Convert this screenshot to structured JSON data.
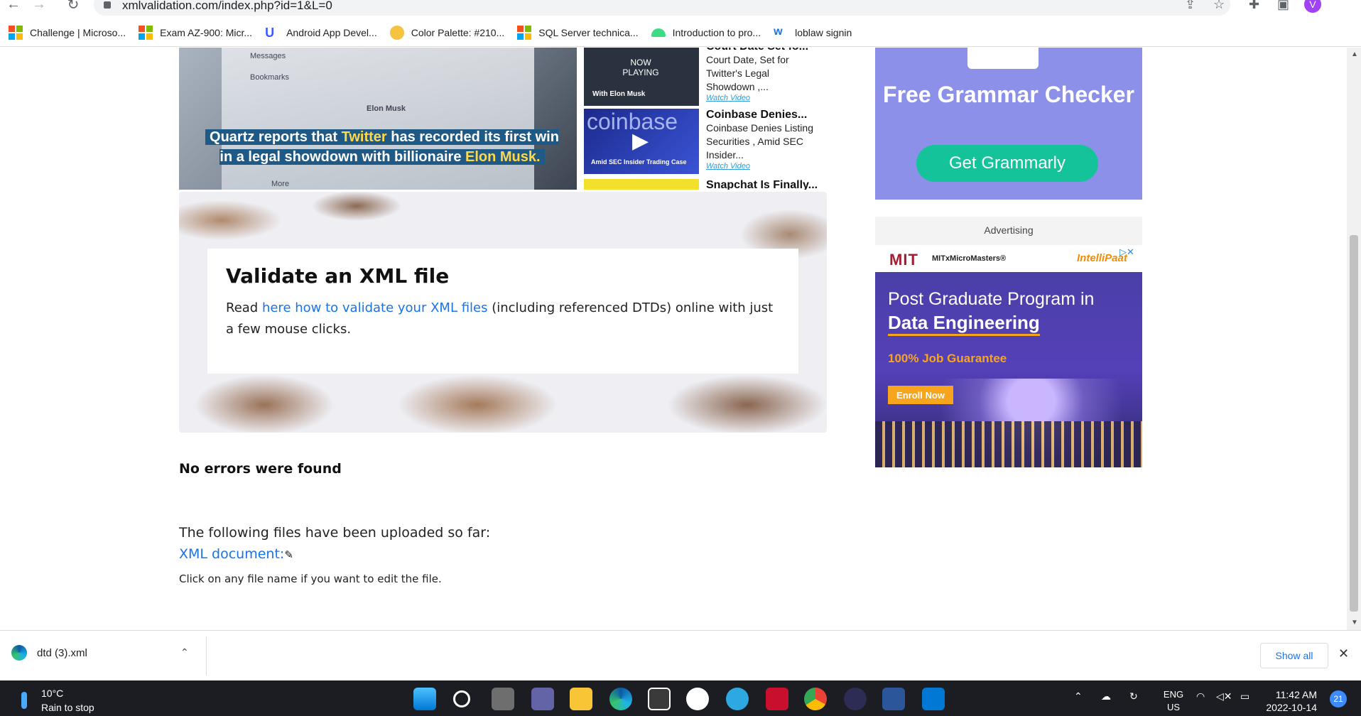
{
  "browser": {
    "url": "xmlvalidation.com/index.php?id=1&L=0",
    "profile_initial": "V",
    "bookmarks": [
      {
        "label": "Challenge | Microso...",
        "icon": "microsoft-icon"
      },
      {
        "label": "Exam AZ-900: Micr...",
        "icon": "microsoft-icon"
      },
      {
        "label": "Android App Devel...",
        "icon": "udacity-icon"
      },
      {
        "label": "Color Palette: #210...",
        "icon": "palette-icon"
      },
      {
        "label": "SQL Server technica...",
        "icon": "microsoft-icon"
      },
      {
        "label": "Introduction to pro...",
        "icon": "android-icon"
      },
      {
        "label": "loblaw signin",
        "icon": "w-icon"
      }
    ]
  },
  "hero_video": {
    "caption_part1": "Quartz reports that ",
    "caption_hl1": "Twitter",
    "caption_part2": " has recorded its first win in a legal showdown with billionaire ",
    "caption_hl2": "Elon Musk.",
    "side_items": [
      "Messages",
      "Bookmarks",
      "Elon Musk",
      "More"
    ]
  },
  "video_list": [
    {
      "title": "Court Date Set fo...",
      "desc": "Court Date, Set for Twitter's Legal Showdown ,...",
      "link": "Watch Video",
      "thumb_label": "NOW PLAYING",
      "thumb_sub": "With Elon Musk"
    },
    {
      "title": "Coinbase Denies...",
      "desc": "Coinbase Denies Listing Securities , Amid SEC Insider...",
      "link": "Watch Video",
      "thumb_label": "coinbase",
      "thumb_sub": "Amid SEC Insider Trading Case"
    },
    {
      "title": "Snapchat Is Finally...",
      "desc": "",
      "link": "",
      "thumb_label": "",
      "thumb_sub": ""
    }
  ],
  "validate": {
    "heading": "Validate an XML file",
    "text_before": "Read ",
    "link_text": "here how to validate your XML files",
    "text_after": " (including referenced DTDs) online with just a few mouse clicks."
  },
  "result": {
    "status": "No errors were found",
    "uploaded_text": "The following files have been uploaded so far:",
    "file_link": "XML document:",
    "hint": "Click on any file name if you want to edit the file."
  },
  "ad_grammarly": {
    "headline": "Free Grammar Checker",
    "cta": "Get Grammarly"
  },
  "ad_mit": {
    "label": "Advertising",
    "brand": "MIT",
    "brand_sub": "MITxMicroMasters®",
    "partner": "IntelliPaat",
    "line1": "Post Graduate Program in",
    "line2": "Data Engineering",
    "line3": "100% Job Guarantee",
    "cta": "Enroll Now"
  },
  "download_bar": {
    "file_name": "dtd (3).xml",
    "show_all": "Show all"
  },
  "taskbar": {
    "temperature": "10°C",
    "weather": "Rain to stop",
    "language_1": "ENG",
    "language_2": "US",
    "time": "11:42 AM",
    "date": "2022-10-14",
    "notifications": "21"
  },
  "colors": {
    "link": "#1a73e8",
    "grammarly_bg": "#8c90e8",
    "grammarly_cta": "#15c39a",
    "mit_accent": "#f7a51c"
  }
}
